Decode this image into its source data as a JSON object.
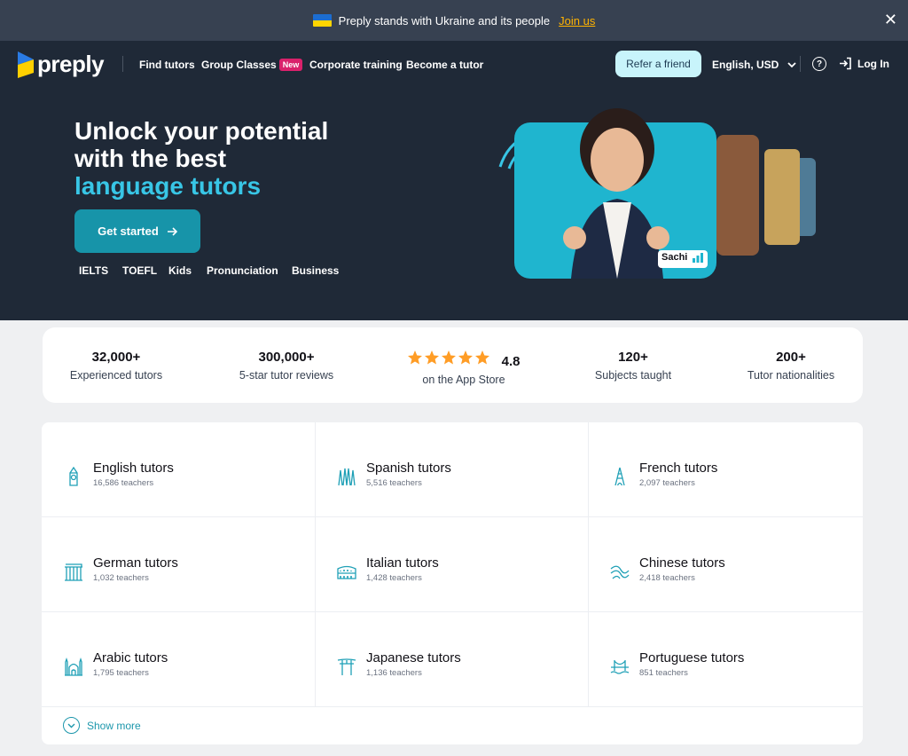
{
  "banner": {
    "text": "Preply stands with Ukraine and its people",
    "link": "Join us",
    "close": "✕"
  },
  "nav": {
    "logo": "preply",
    "links": [
      {
        "label": "Find tutors"
      },
      {
        "label": "Group Classes",
        "badge": "New"
      },
      {
        "label": "Corporate training"
      },
      {
        "label": "Become a tutor"
      }
    ],
    "refer": "Refer a friend",
    "language": "English, USD",
    "help": "?",
    "login": "Log In"
  },
  "hero": {
    "line1": "Unlock your potential",
    "line2": "with the best",
    "line3": "language tutors",
    "cta": "Get started",
    "tags": [
      "IELTS",
      "TOEFL",
      "Kids",
      "Pronunciation",
      "Business"
    ],
    "tutor_name": "Sachi"
  },
  "stats": [
    {
      "value": "32,000+",
      "label": "Experienced tutors"
    },
    {
      "value": "300,000+",
      "label": "5-star tutor reviews"
    },
    {
      "value": "4.8",
      "label": "on the App Store",
      "stars": 5
    },
    {
      "value": "120+",
      "label": "Subjects taught"
    },
    {
      "value": "200+",
      "label": "Tutor nationalities"
    }
  ],
  "categories": [
    {
      "title": "English tutors",
      "count": "16,586 teachers",
      "icon": "big-ben-icon"
    },
    {
      "title": "Spanish tutors",
      "count": "5,516 teachers",
      "icon": "sagrada-familia-icon"
    },
    {
      "title": "French tutors",
      "count": "2,097 teachers",
      "icon": "eiffel-tower-icon"
    },
    {
      "title": "German tutors",
      "count": "1,032 teachers",
      "icon": "brandenburg-gate-icon"
    },
    {
      "title": "Italian tutors",
      "count": "1,428 teachers",
      "icon": "colosseum-icon"
    },
    {
      "title": "Chinese tutors",
      "count": "2,418 teachers",
      "icon": "great-wall-icon"
    },
    {
      "title": "Arabic tutors",
      "count": "1,795 teachers",
      "icon": "mosque-icon"
    },
    {
      "title": "Japanese tutors",
      "count": "1,136 teachers",
      "icon": "torii-gate-icon"
    },
    {
      "title": "Portuguese tutors",
      "count": "851 teachers",
      "icon": "bridge-icon"
    }
  ],
  "show_more": "Show more",
  "colors": {
    "hero_bg": "#1f2937",
    "accent": "#38c6e6",
    "cta": "#1794a9",
    "star": "#ff9d26",
    "link": "#1d97ac"
  }
}
